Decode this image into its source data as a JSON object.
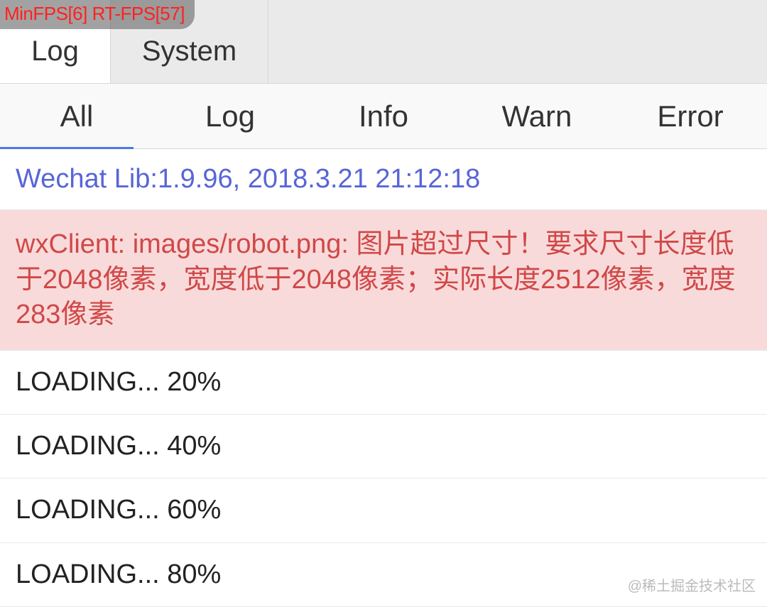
{
  "fps": {
    "minfps_label": "MinFPS",
    "minfps_value": 6,
    "rtfps_label": "RT-FPS",
    "rtfps_value": 57
  },
  "top_tabs": {
    "log": "Log",
    "system": "System"
  },
  "filter_tabs": {
    "all": "All",
    "log": "Log",
    "info": "Info",
    "warn": "Warn",
    "error": "Error"
  },
  "entries": {
    "lib_info": "Wechat Lib:1.9.96, 2018.3.21 21:12:18",
    "error_msg": "wxClient: images/robot.png: 图片超过尺寸！要求尺寸长度低于2048像素，宽度低于2048像素；实际长度2512像素，宽度283像素",
    "loading20": "LOADING... 20%",
    "loading40": "LOADING... 40%",
    "loading60": "LOADING... 60%",
    "loading80": "LOADING... 80%"
  },
  "watermark": "@稀土掘金技术社区"
}
